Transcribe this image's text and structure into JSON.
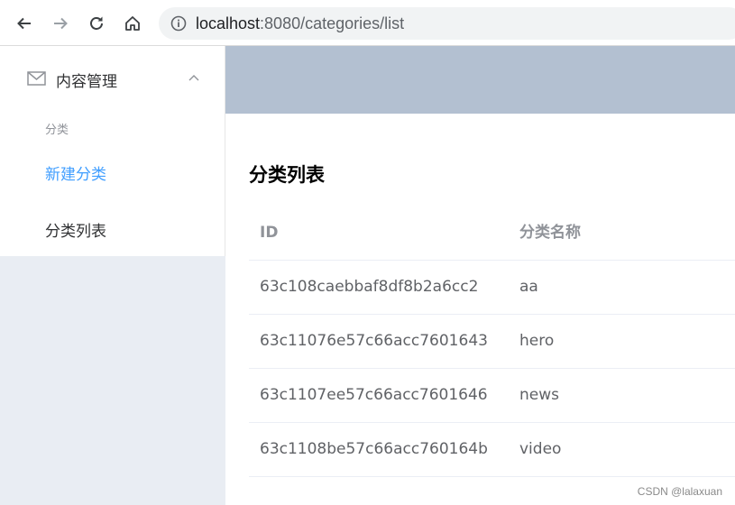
{
  "browser": {
    "url_host": "localhost",
    "url_rest": ":8080/categories/list"
  },
  "sidebar": {
    "submenu_title": "内容管理",
    "group_title": "分类",
    "items": [
      {
        "label": "新建分类",
        "active": true
      },
      {
        "label": "分类列表",
        "active": false
      }
    ]
  },
  "main": {
    "title": "分类列表",
    "table": {
      "columns": [
        "ID",
        "分类名称"
      ],
      "rows": [
        [
          "63c108caebbaf8df8b2a6cc2",
          "aa"
        ],
        [
          "63c11076e57c66acc7601643",
          "hero"
        ],
        [
          "63c1107ee57c66acc7601646",
          "news"
        ],
        [
          "63c1108be57c66acc760164b",
          "video"
        ]
      ]
    }
  },
  "watermark": "CSDN @lalaxuan",
  "colors": {
    "header": "#b3c0d1",
    "aside": "#e9edf3",
    "active": "#409eff"
  }
}
